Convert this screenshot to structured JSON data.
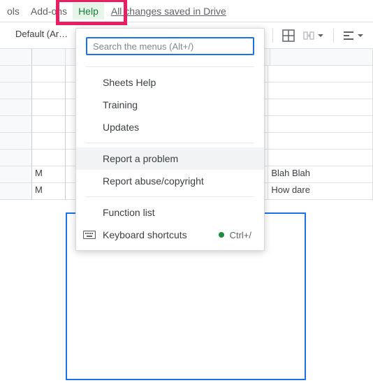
{
  "menubar": {
    "tools": "ols",
    "addons": "Add-ons",
    "help": "Help",
    "save_status": "All changes saved in Drive"
  },
  "toolbar": {
    "font_selector": "Default (Ari…"
  },
  "dropdown": {
    "search_placeholder": "Search the menus (Alt+/)",
    "sheets_help": "Sheets Help",
    "training": "Training",
    "updates": "Updates",
    "report_problem": "Report a problem",
    "report_abuse": "Report abuse/copyright",
    "function_list": "Function list",
    "keyboard_shortcuts": "Keyboard shortcuts",
    "shortcut_hint": "Ctrl+/"
  },
  "sheet": {
    "row7_colA": "M",
    "row7_colC": "Blah Blah",
    "row8_colA": "M",
    "row8_colC": "How dare"
  }
}
